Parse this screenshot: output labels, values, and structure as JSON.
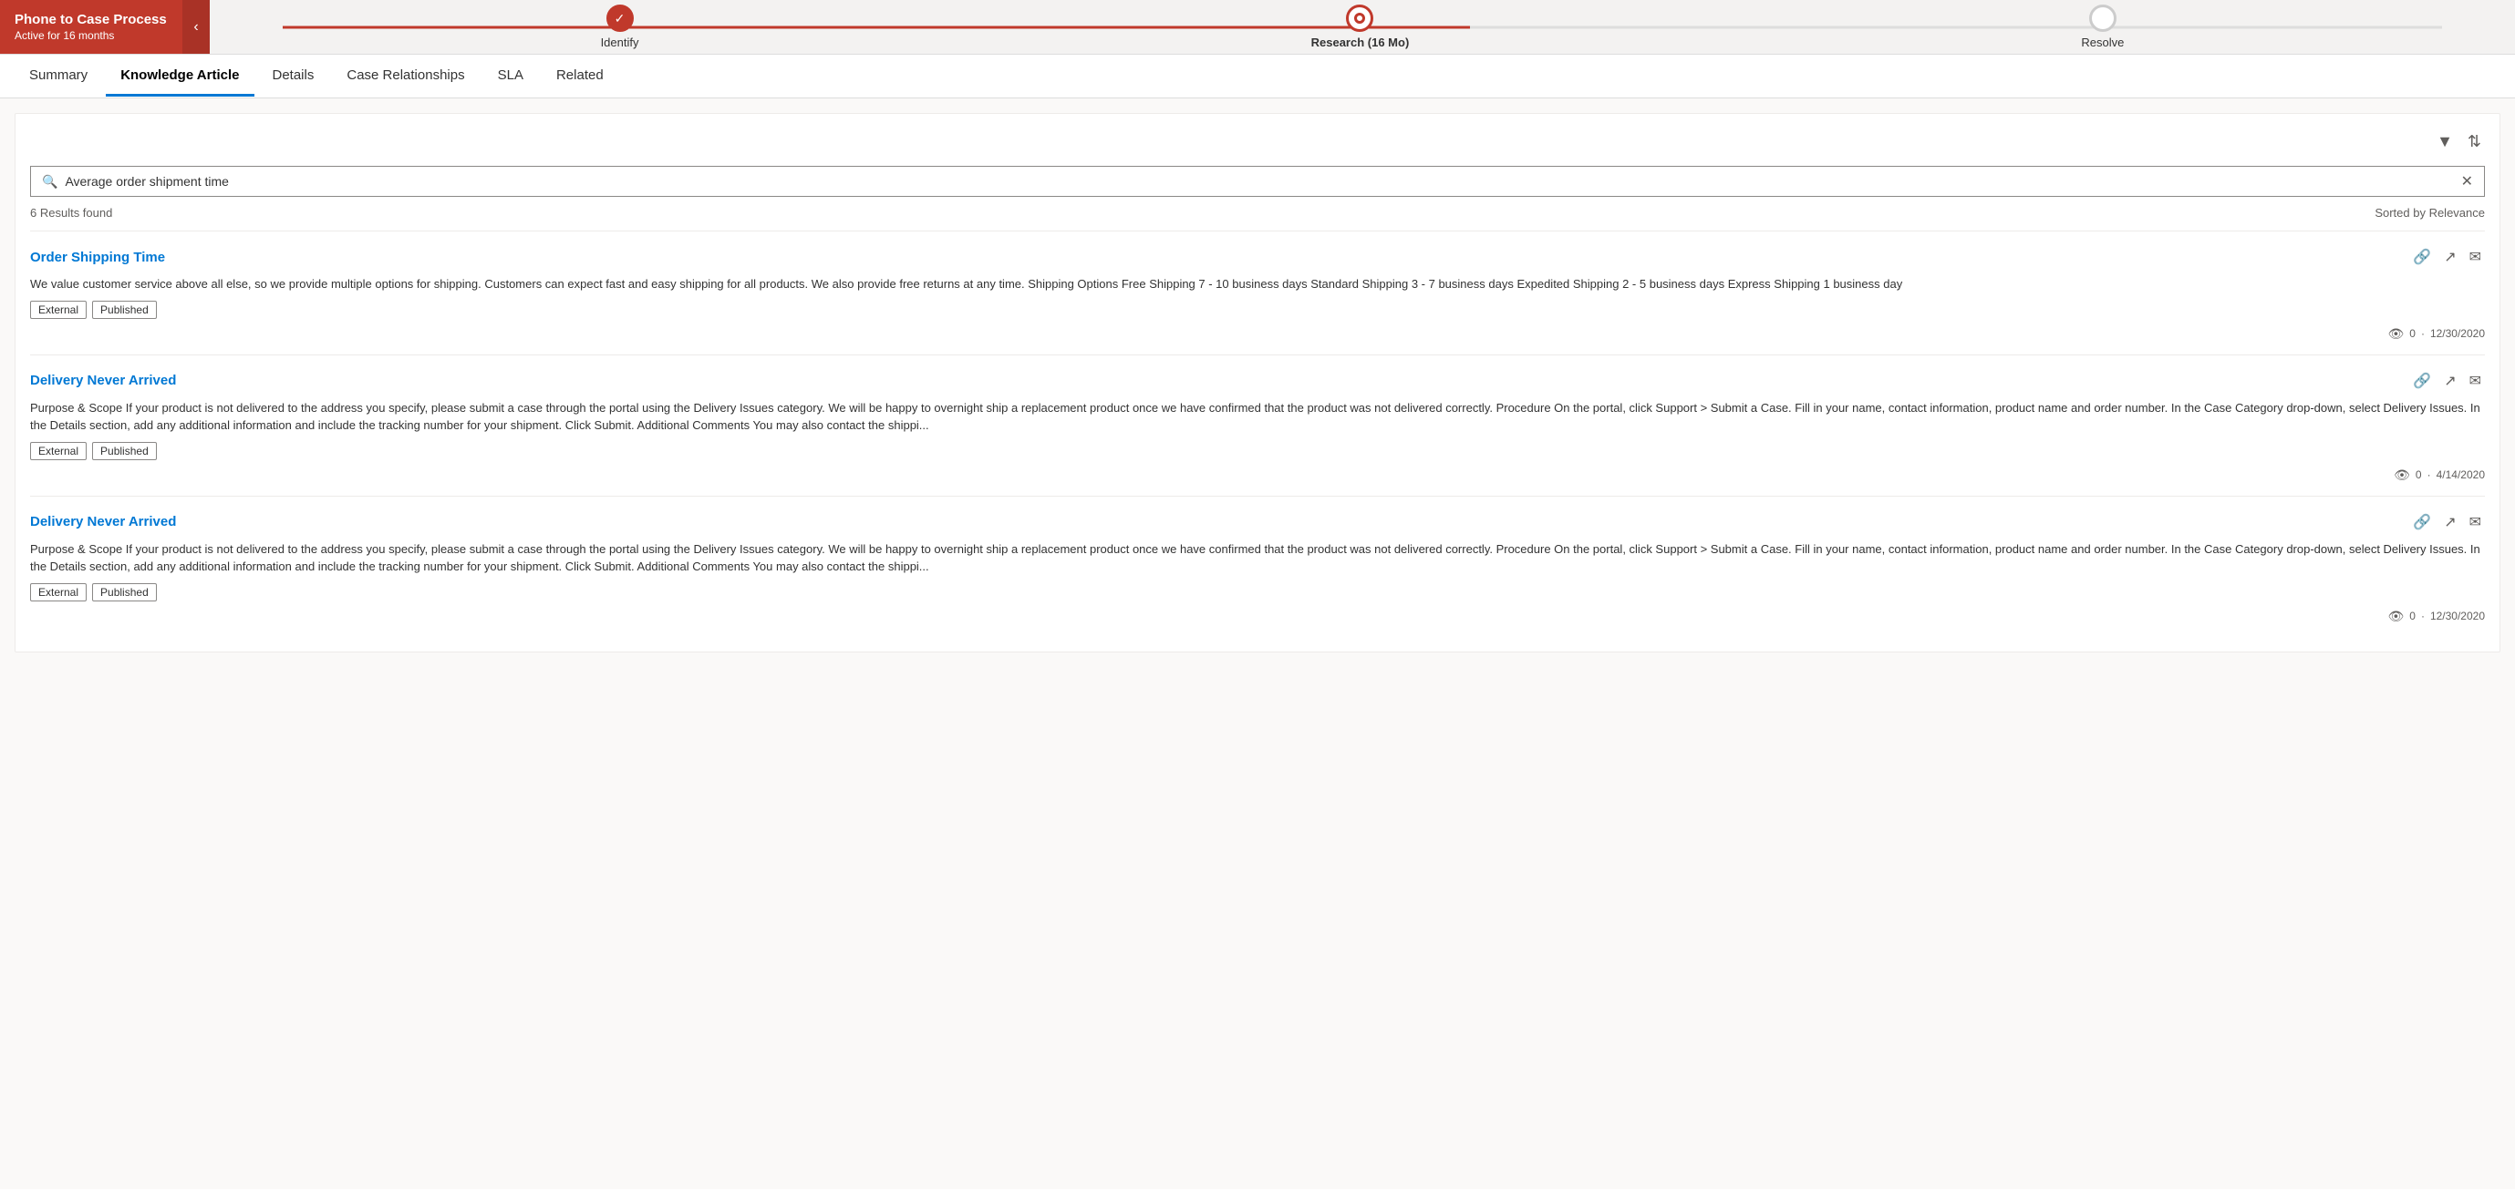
{
  "process": {
    "title": "Phone to Case Process",
    "subtitle": "Active for 16 months",
    "collapse_icon": "‹",
    "steps": [
      {
        "id": "identify",
        "label": "Identify",
        "state": "done"
      },
      {
        "id": "research",
        "label": "Research  (16 Mo)",
        "state": "active"
      },
      {
        "id": "resolve",
        "label": "Resolve",
        "state": "inactive"
      }
    ]
  },
  "nav": {
    "tabs": [
      {
        "id": "summary",
        "label": "Summary",
        "active": false
      },
      {
        "id": "knowledge-article",
        "label": "Knowledge Article",
        "active": true
      },
      {
        "id": "details",
        "label": "Details",
        "active": false
      },
      {
        "id": "case-relationships",
        "label": "Case Relationships",
        "active": false
      },
      {
        "id": "sla",
        "label": "SLA",
        "active": false
      },
      {
        "id": "related",
        "label": "Related",
        "active": false
      }
    ]
  },
  "toolbar": {
    "filter_icon": "▼",
    "sort_icon": "⇅"
  },
  "search": {
    "placeholder": "Average order shipment time",
    "value": "Average order shipment time",
    "clear_icon": "✕"
  },
  "results": {
    "count_label": "6 Results found",
    "sort_label": "Sorted by Relevance"
  },
  "articles": [
    {
      "id": "article-1",
      "title": "Order Shipping Time",
      "body": "We value customer service above all else, so we provide multiple options for shipping. Customers can expect fast and easy shipping for all products. We also provide free returns at any time. Shipping Options Free Shipping 7 - 10 business days Standard Shipping 3 - 7 business days Expedited Shipping 2 - 5 business days Express Shipping 1 business day",
      "tags": [
        "External",
        "Published"
      ],
      "views": "0",
      "date": "12/30/2020"
    },
    {
      "id": "article-2",
      "title": "Delivery Never Arrived",
      "body": "Purpose & Scope If your product is not delivered to the address you specify, please submit a case through the portal using the Delivery Issues category. We will be happy to overnight ship a replacement product once we have confirmed that the product was not delivered correctly. Procedure On the portal, click Support > Submit a Case. Fill in your name, contact information, product name and order number. In the Case Category drop-down, select Delivery Issues. In the Details section, add any additional information and include the tracking number for your shipment. Click Submit. Additional Comments You may also contact the shippi...",
      "tags": [
        "External",
        "Published"
      ],
      "views": "0",
      "date": "4/14/2020"
    },
    {
      "id": "article-3",
      "title": "Delivery Never Arrived",
      "body": "Purpose & Scope If your product is not delivered to the address you specify, please submit a case through the portal using the Delivery Issues category. We will be happy to overnight ship a replacement product once we have confirmed that the product was not delivered correctly. Procedure On the portal, click Support > Submit a Case. Fill in your name, contact information, product name and order number. In the Case Category drop-down, select Delivery Issues. In the Details section, add any additional information and include the tracking number for your shipment. Click Submit. Additional Comments You may also contact the shippi...",
      "tags": [
        "External",
        "Published"
      ],
      "views": "0",
      "date": "12/30/2020"
    }
  ]
}
